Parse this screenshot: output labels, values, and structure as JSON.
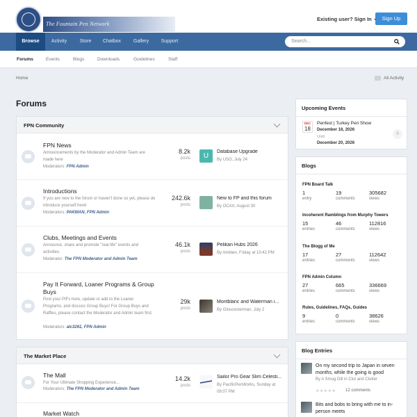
{
  "header": {
    "site_title": "The Fountain Pen Network",
    "signin_label": "Existing user? Sign In",
    "signup_label": "Sign Up"
  },
  "nav": {
    "items": [
      "Browse",
      "Activity",
      "Store",
      "Chatbox",
      "Gallery",
      "Support"
    ],
    "active": "Browse",
    "search_placeholder": "Search..."
  },
  "subnav": {
    "items": [
      "Forums",
      "Events",
      "Blogs",
      "Downloads",
      "Guidelines",
      "Staff"
    ],
    "active": "Forums"
  },
  "breadcrumb": "Home",
  "all_activity": "All Activity",
  "page_title": "Forums",
  "sections": [
    {
      "title": "FPN Community",
      "forums": [
        {
          "name": "FPN News",
          "description": "Announcements by the Moderator and Admin Team are made here",
          "mods_label": "Moderators:",
          "mods": "FPN Admin",
          "posts": "8.2k",
          "posts_label": "posts",
          "last_title": "Database Upgrade",
          "last_by": "By USO, July 24",
          "avatar_letter": "U",
          "avatar_color": "#4bb8b0"
        },
        {
          "name": "Introductions",
          "description": "If you are new to the forum or haven't done so yet, please do introduce yourself here!",
          "mods_label": "Moderators:",
          "mods": "PAKMAN, FPN Admin",
          "posts": "242.6k",
          "posts_label": "posts",
          "last_title": "New to FP and this forum",
          "last_by": "By OCArt, August 30",
          "avatar_color": "#7fb3a0"
        },
        {
          "name": "Clubs, Meetings and Events",
          "description": "Announce, share and promote \"real life\" events and activities.",
          "mods_label": "Moderator:",
          "mods": "The FPN Moderator and Admin Team",
          "posts": "46.1k",
          "posts_label": "posts",
          "last_title": "Pelikan Hubs 2026",
          "last_by": "By Ambien, Friday at 10:42 PM",
          "avatar_color": "#7a3a2a"
        },
        {
          "name": "Pay It Forward, Loaner Programs & Group Buys",
          "description": "Post your PIFs here, update or add to the Loaner Programs, and discuss Group Buys! For Group Buys and Raffles, please contact the Moderator and Admin team first.",
          "mods_label": "Moderators:",
          "mods": "alc3261, FPN Admin",
          "posts": "29k",
          "posts_label": "posts",
          "last_title": "Montblanc and Waterman i...",
          "last_by": "By Gloucesterman, July 2",
          "avatar_color": "#5b5148"
        }
      ]
    },
    {
      "title": "The Market Place",
      "forums": [
        {
          "name": "The Mall",
          "description": "For Your Ultimate Shopping Experience...",
          "mods_label": "Moderators:",
          "mods": "The FPN Moderator and Admin Team",
          "posts": "14.2k",
          "posts_label": "posts",
          "last_title": "Sailor Pro Gear Slim Celesti...",
          "last_by": "By PacificPenWorks, Sunday at 08:07 PM",
          "avatar_color": "#eef1f4"
        },
        {
          "name": "Market Watch"
        }
      ]
    }
  ],
  "events": {
    "title": "Upcoming Events",
    "month": "DEC",
    "day": "18",
    "name": "Penfest | Turkey Pen Show",
    "start": "December 18, 2026",
    "until": "Until",
    "end": "December 20, 2026",
    "count": "0"
  },
  "blogs": {
    "title": "Blogs",
    "items": [
      {
        "name": "FPN Board Talk",
        "stats": [
          {
            "n": "1",
            "l": "entry"
          },
          {
            "n": "19",
            "l": "comments"
          },
          {
            "n": "305682",
            "l": "views"
          }
        ]
      },
      {
        "name": "Incoherent Ramblings from Murphy Towers",
        "stats": [
          {
            "n": "15",
            "l": "entries"
          },
          {
            "n": "46",
            "l": "comments"
          },
          {
            "n": "112816",
            "l": "views"
          }
        ]
      },
      {
        "name": "The Blogg of Me",
        "stats": [
          {
            "n": "17",
            "l": "entries"
          },
          {
            "n": "27",
            "l": "comments"
          },
          {
            "n": "112642",
            "l": "views"
          }
        ]
      },
      {
        "name": "FPN Admin Column",
        "stats": [
          {
            "n": "27",
            "l": "entries"
          },
          {
            "n": "665",
            "l": "comments"
          },
          {
            "n": "336669",
            "l": "views"
          }
        ]
      },
      {
        "name": "Rules, Guidelines, FAQs, Guides",
        "stats": [
          {
            "n": "9",
            "l": "entries"
          },
          {
            "n": "0",
            "l": "comments"
          },
          {
            "n": "38626",
            "l": "views"
          }
        ]
      }
    ]
  },
  "blog_entries": {
    "title": "Blog Entries",
    "items": [
      {
        "title": "On my second trip to Japan in seven months, while the going is good",
        "by": "By A Smug Dill in Clut and Clutter",
        "comments": "12 comments"
      },
      {
        "title": "Bits and bobs to bring with me to in-person meets"
      }
    ]
  }
}
